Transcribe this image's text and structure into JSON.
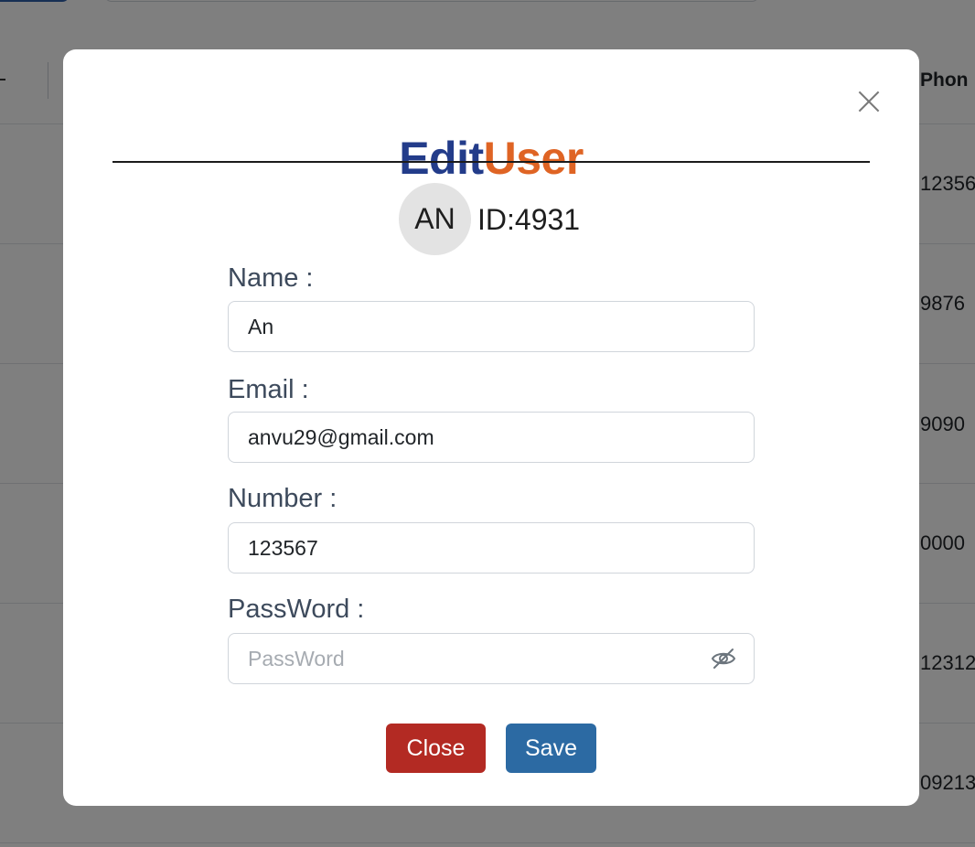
{
  "background": {
    "table": {
      "phone_header": "Phon",
      "phone_cells": [
        "12356",
        "9876",
        "9090",
        "0000",
        "12312",
        "09213"
      ]
    }
  },
  "modal": {
    "title_part1": "Edit",
    "title_part2": "User",
    "close_icon": "close-x-icon",
    "avatar_initials": "AN",
    "user_id": "ID:4931",
    "fields": {
      "name": {
        "label": "Name :",
        "value": "An"
      },
      "email": {
        "label": "Email :",
        "value": "anvu29@gmail.com"
      },
      "number": {
        "label": "Number :",
        "value": "123567"
      },
      "password": {
        "label": "PassWord :",
        "value": "",
        "placeholder": "PassWord",
        "toggle_icon": "eye-slash-icon"
      }
    },
    "buttons": {
      "close_label": "Close",
      "save_label": "Save"
    }
  },
  "colors": {
    "title_edit": "#233c8a",
    "title_user": "#df6424",
    "close_button": "#b32a23",
    "save_button": "#2c6aa3",
    "backdrop": "rgba(0,0,0,0.5)"
  }
}
